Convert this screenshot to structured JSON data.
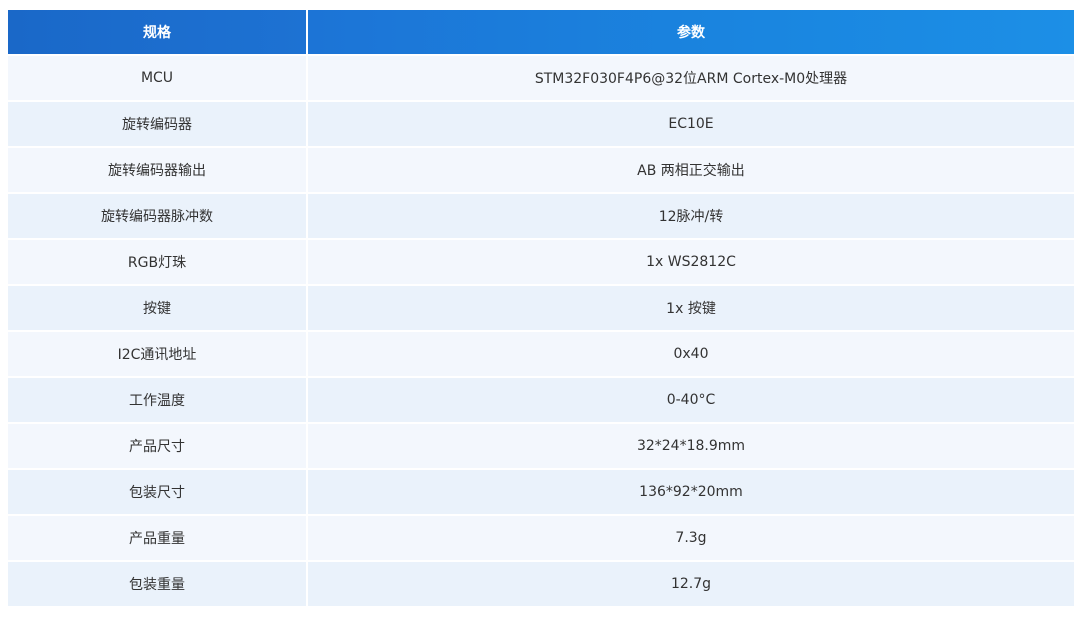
{
  "header": {
    "col1": "规格",
    "col2": "参数"
  },
  "rows": [
    {
      "spec": "MCU",
      "value": "STM32F030F4P6@32位ARM Cortex-M0处理器"
    },
    {
      "spec": "旋转编码器",
      "value": "EC10E"
    },
    {
      "spec": "旋转编码器输出",
      "value": "AB 两相正交输出"
    },
    {
      "spec": "旋转编码器脉冲数",
      "value": "12脉冲/转"
    },
    {
      "spec": "RGB灯珠",
      "value": "1x WS2812C"
    },
    {
      "spec": "按键",
      "value": "1x 按键"
    },
    {
      "spec": "I2C通讯地址",
      "value": "0x40"
    },
    {
      "spec": "工作温度",
      "value": "0-40°C"
    },
    {
      "spec": "产品尺寸",
      "value": "32*24*18.9mm"
    },
    {
      "spec": "包装尺寸",
      "value": "136*92*20mm"
    },
    {
      "spec": "产品重量",
      "value": "7.3g"
    },
    {
      "spec": "包装重量",
      "value": "12.7g"
    }
  ],
  "colors": {
    "header_blue": "#1a72d4",
    "row_light": "#f3f7fd",
    "row_alt": "#eaf2fb",
    "text": "#333333"
  }
}
